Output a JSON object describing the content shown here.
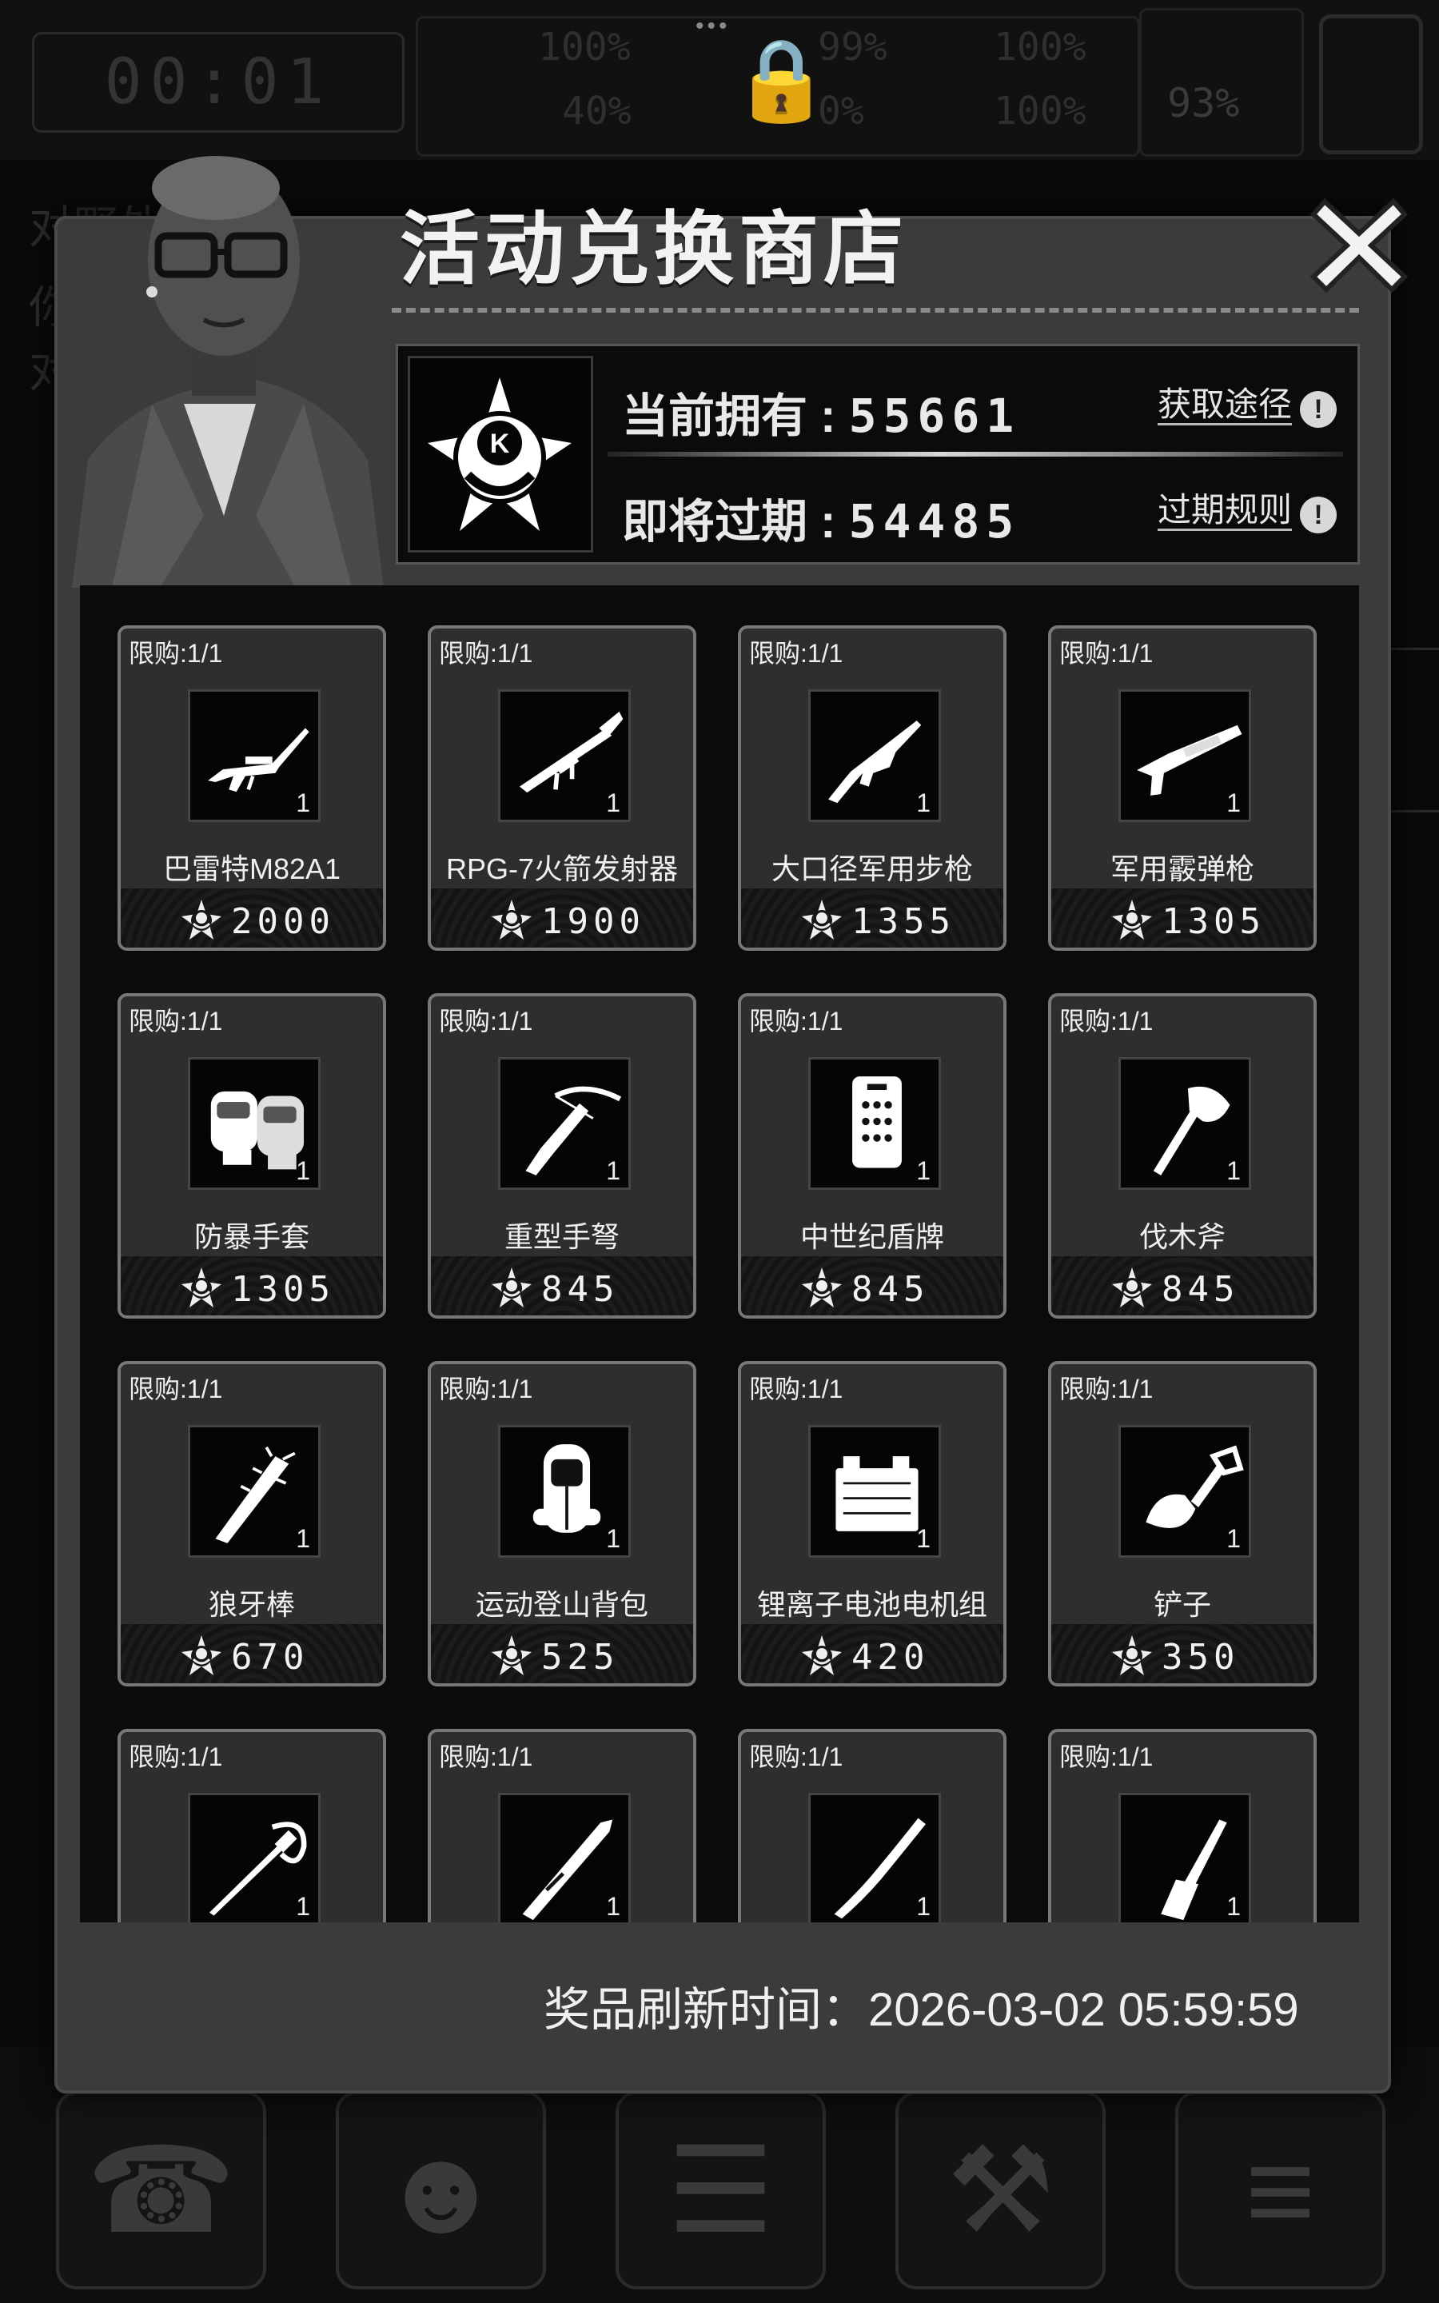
{
  "hud": {
    "timer": "00:01",
    "stats": [
      "100%",
      "99%",
      "100%",
      "40%",
      "0%",
      "100%"
    ],
    "right_percent": "93%"
  },
  "background_text": [
    "对野外",
    "你",
    "对"
  ],
  "bottom_nav": [
    {
      "icon": "backpack-icon"
    },
    {
      "icon": "brain-icon"
    },
    {
      "icon": "journal-icon"
    },
    {
      "icon": "cart-icon"
    },
    {
      "icon": "menu-list-icon"
    }
  ],
  "shop": {
    "title": "活动兑换商店",
    "currency": {
      "owned_label": "当前拥有",
      "owned_value": "55661",
      "expiring_label": "即将过期",
      "expiring_value": "54485",
      "obtain_link": "获取途径",
      "expire_rules_link": "过期规则"
    },
    "items": [
      {
        "limit": "限购:1/1",
        "name": "巴雷特M82A1",
        "qty": "1",
        "price": "2000",
        "icon": "sniper-rifle-icon"
      },
      {
        "limit": "限购:1/1",
        "name": "RPG-7火箭发射器",
        "qty": "1",
        "price": "1900",
        "icon": "rocket-launcher-icon"
      },
      {
        "limit": "限购:1/1",
        "name": "大口径军用步枪",
        "qty": "1",
        "price": "1355",
        "icon": "assault-rifle-icon"
      },
      {
        "limit": "限购:1/1",
        "name": "军用霰弹枪",
        "qty": "1",
        "price": "1305",
        "icon": "shotgun-icon"
      },
      {
        "limit": "限购:1/1",
        "name": "防暴手套",
        "qty": "1",
        "price": "1305",
        "icon": "gloves-icon"
      },
      {
        "limit": "限购:1/1",
        "name": "重型手弩",
        "qty": "1",
        "price": "845",
        "icon": "crossbow-icon"
      },
      {
        "limit": "限购:1/1",
        "name": "中世纪盾牌",
        "qty": "1",
        "price": "845",
        "icon": "shield-icon"
      },
      {
        "limit": "限购:1/1",
        "name": "伐木斧",
        "qty": "1",
        "price": "845",
        "icon": "axe-icon"
      },
      {
        "limit": "限购:1/1",
        "name": "狼牙棒",
        "qty": "1",
        "price": "670",
        "icon": "spiked-club-icon"
      },
      {
        "limit": "限购:1/1",
        "name": "运动登山背包",
        "qty": "1",
        "price": "525",
        "icon": "hiking-backpack-icon"
      },
      {
        "limit": "限购:1/1",
        "name": "锂离子电池电机组",
        "qty": "1",
        "price": "420",
        "icon": "battery-icon"
      },
      {
        "limit": "限购:1/1",
        "name": "铲子",
        "qty": "1",
        "price": "350",
        "icon": "shovel-icon"
      },
      {
        "limit": "限购:1/1",
        "name": "",
        "qty": "1",
        "price": "",
        "icon": "sabre-icon"
      },
      {
        "limit": "限购:1/1",
        "name": "",
        "qty": "1",
        "price": "",
        "icon": "knife-icon"
      },
      {
        "limit": "限购:1/1",
        "name": "",
        "qty": "1",
        "price": "",
        "icon": "branch-club-icon"
      },
      {
        "limit": "限购:1/1",
        "name": "",
        "qty": "1",
        "price": "",
        "icon": "chisel-icon"
      }
    ],
    "refresh_label": "奖品刷新时间：",
    "refresh_time": "2026-03-02 05:59:59"
  }
}
